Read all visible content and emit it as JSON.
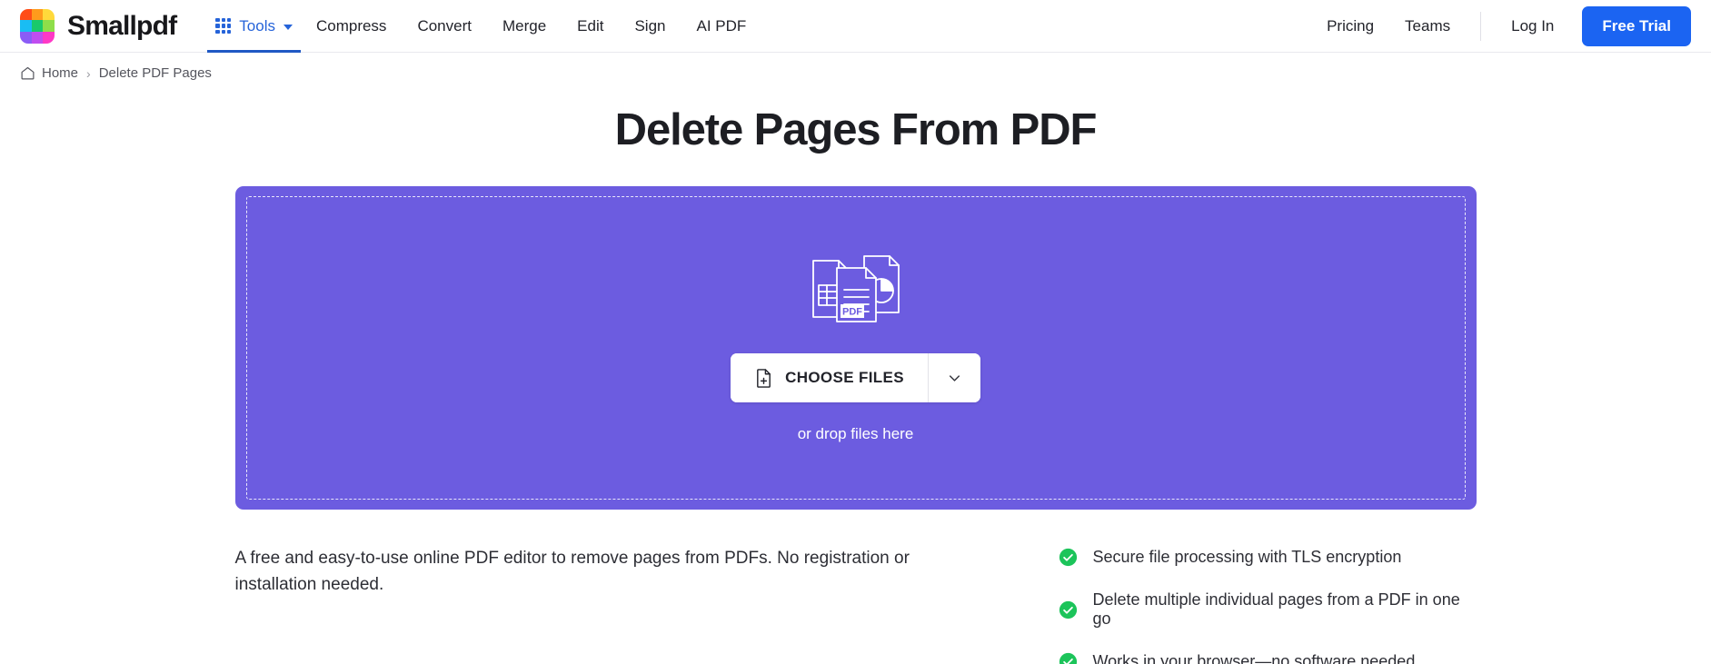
{
  "header": {
    "brand_name": "Smallpdf",
    "logo_colors": [
      "#ff4d17",
      "#ff9b1c",
      "#ffd93b",
      "#19bdf3",
      "#19c96b",
      "#8ede4a",
      "#8b5cf6",
      "#c04df0",
      "#ff39c6"
    ],
    "tools": {
      "label": "Tools",
      "icon": "grid-dots-icon",
      "caret_icon": "chevron-down-icon",
      "active": true,
      "accent": "#2563d9"
    },
    "nav_links": [
      {
        "label": "Compress"
      },
      {
        "label": "Convert"
      },
      {
        "label": "Merge"
      },
      {
        "label": "Edit"
      },
      {
        "label": "Sign"
      },
      {
        "label": "AI PDF"
      }
    ],
    "right_links": [
      {
        "label": "Pricing"
      },
      {
        "label": "Teams"
      }
    ],
    "login_label": "Log In",
    "free_trial_label": "Free Trial",
    "free_trial_color": "#1b64f2"
  },
  "breadcrumb": {
    "home_icon": "home-icon",
    "home_label": "Home",
    "separator": "›",
    "current_label": "Delete PDF Pages"
  },
  "page": {
    "title": "Delete Pages From PDF"
  },
  "dropzone": {
    "background_color": "#6c5ce0",
    "documents_icon": "documents-stack-icon",
    "choose_files_label": "CHOOSE FILES",
    "choose_files_icon": "file-plus-icon",
    "dropdown_icon": "chevron-down-icon",
    "drop_hint": "or drop files here"
  },
  "description": "A free and easy-to-use online PDF editor to remove pages from PDFs. No registration or installation needed.",
  "features": {
    "check_color": "#1cc45a",
    "items": [
      {
        "label": "Secure file processing with TLS encryption"
      },
      {
        "label": "Delete multiple individual pages from a PDF in one go"
      },
      {
        "label": "Works in your browser—no software needed"
      }
    ]
  }
}
